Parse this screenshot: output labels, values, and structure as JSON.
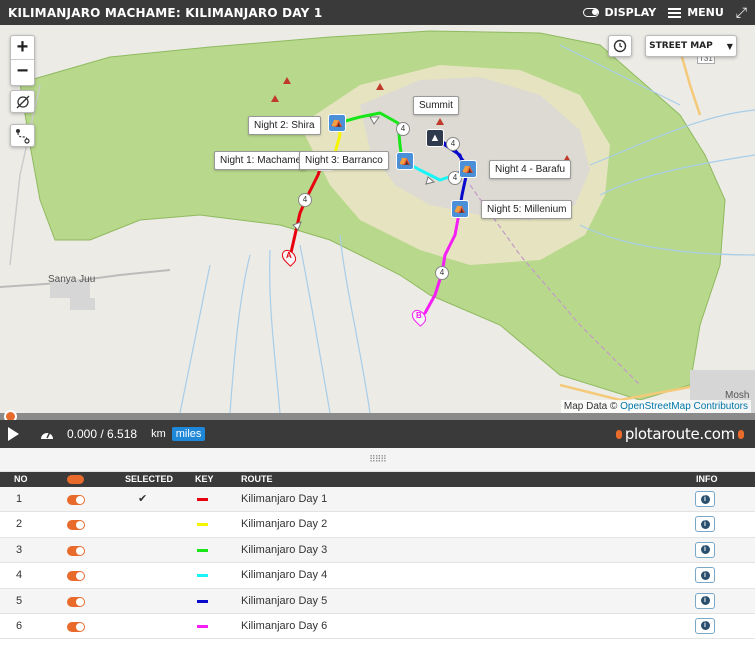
{
  "header": {
    "title": "KILIMANJARO MACHAME: KILIMANJARO DAY 1",
    "display_label": "DISPLAY",
    "menu_label": "MENU"
  },
  "map": {
    "zoom_in": "+",
    "zoom_out": "−",
    "map_type": "STREET MAP",
    "attribution_prefix": "Map Data © ",
    "attribution_link": "OpenStreetMap Contributors",
    "place_sanya": "Sanya Juu",
    "place_moshi": "Mosh",
    "road_label": "T31",
    "labels": {
      "summit": "Summit",
      "night2": "Night 2: Shira",
      "night1": "Night 1: Machame",
      "night3": "Night 3: Barranco",
      "night4": "Night 4 - Barafu",
      "night5": "Night 5: Millenium"
    },
    "distance_marker": "4",
    "start_marker": "A",
    "end_marker": "B",
    "colors": {
      "park": "#b8d88c",
      "rock": "#dcdad2",
      "moor": "#e6e4c0",
      "river": "#a8cde8"
    }
  },
  "player": {
    "distance": "0.000 / 6.518",
    "unit_km": "km",
    "unit_miles": "miles",
    "logo": "plotaroute.com"
  },
  "table": {
    "headers": {
      "no": "NO",
      "selected": "SELECTED",
      "key": "KEY",
      "route": "ROUTE",
      "info": "INFO"
    },
    "rows": [
      {
        "no": "1",
        "selected": "✔",
        "color": "#e8000e",
        "route": "Kilimanjaro Day 1"
      },
      {
        "no": "2",
        "selected": "",
        "color": "#f5f500",
        "route": "Kilimanjaro Day 2"
      },
      {
        "no": "3",
        "selected": "",
        "color": "#19e619",
        "route": "Kilimanjaro Day 3"
      },
      {
        "no": "4",
        "selected": "",
        "color": "#19f5f5",
        "route": "Kilimanjaro Day 4"
      },
      {
        "no": "5",
        "selected": "",
        "color": "#0a0acd",
        "route": "Kilimanjaro Day 5"
      },
      {
        "no": "6",
        "selected": "",
        "color": "#f51ef5",
        "route": "Kilimanjaro Day 6"
      }
    ]
  }
}
